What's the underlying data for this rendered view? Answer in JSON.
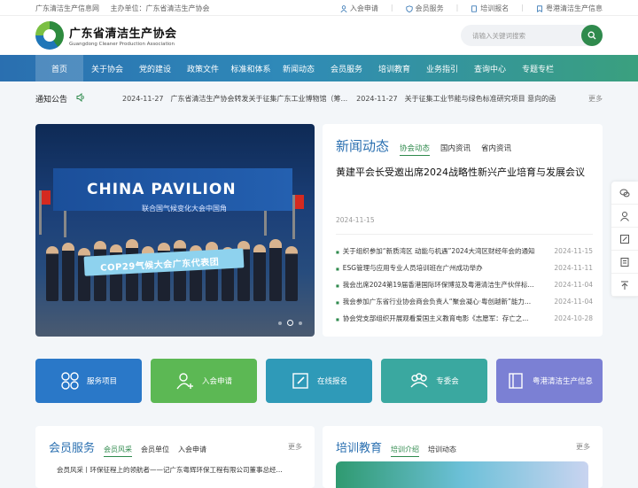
{
  "topbar": {
    "site_name": "广东清洁生产信息网",
    "sponsor": "主办单位：广东省清洁生产协会",
    "links": [
      "入会申请",
      "会员服务",
      "培训报名",
      "粤港清洁生产信息"
    ]
  },
  "header": {
    "logo_cn": "广东省清洁生产协会",
    "logo_en": "Guangdong Cleaner Production Association",
    "search_placeholder": "请输入关键词搜索"
  },
  "nav": {
    "items": [
      "首页",
      "关于协会",
      "党的建设",
      "政策文件",
      "标准和体系",
      "新闻动态",
      "会员服务",
      "培训教育",
      "业务指引",
      "查询中心",
      "专题专栏"
    ],
    "active": "首页"
  },
  "notice": {
    "title": "通知公告",
    "items": [
      {
        "date": "2024-11-27",
        "text": "广东省清洁生产协会转发关于征集广东工业博物馆（筹..."
      },
      {
        "date": "2024-11-27",
        "text": "关于征集工业节能与绿色标准研究项目 意向的函"
      }
    ],
    "more": "更多"
  },
  "banner": {
    "wall_text": "CHINA PAVILION",
    "wall_sub": "联合国气候变化大会中国角",
    "sign_text": "COP29气候大会广东代表团",
    "slides": 3,
    "active_slide": 2
  },
  "news": {
    "title": "新闻动态",
    "tabs": [
      "协会动态",
      "国内资讯",
      "省内资讯"
    ],
    "headline": "黄建平会长受邀出席2024战略性新兴产业培育与发展会议",
    "headline_date": "2024-11-15",
    "list": [
      {
        "text": "关于组织参加“新质湾区 动能与机遇”2024大湾区财经年会的通知",
        "date": "2024-11-15"
      },
      {
        "text": "ESG管理与应用专业人员培训班在广州成功举办",
        "date": "2024-11-11"
      },
      {
        "text": "我会出席2024第19届香港国际环保博览及粤港清洁生产伙伴标...",
        "date": "2024-11-04"
      },
      {
        "text": "我会参加广东省行业协会商会负责人“聚会凝心·粤创越新”能力...",
        "date": "2024-11-04"
      },
      {
        "text": "协会党支部组织开展观看爱国主义教育电影《志愿军：存亡之...",
        "date": "2024-10-28"
      }
    ]
  },
  "quick": {
    "items": [
      {
        "label": "服务项目",
        "icon": "grid-icon"
      },
      {
        "label": "入会申请",
        "icon": "user-add-icon"
      },
      {
        "label": "在线报名",
        "icon": "edit-icon"
      },
      {
        "label": "专委会",
        "icon": "group-icon"
      },
      {
        "label": "粤港清洁生产信息",
        "icon": "book-icon"
      }
    ]
  },
  "member": {
    "title": "会员服务",
    "tabs": [
      "会员风采",
      "会员单位",
      "入会申请"
    ],
    "more": "更多",
    "item": "会员风采丨环保征程上的领航者——记广东粤辉环保工程有限公司董事总经..."
  },
  "training": {
    "title": "培训教育",
    "tabs": [
      "培训介绍",
      "培训动态"
    ],
    "more": "更多"
  },
  "colors": {
    "primary": "#2a6fb0",
    "accent": "#2f8a4d"
  }
}
